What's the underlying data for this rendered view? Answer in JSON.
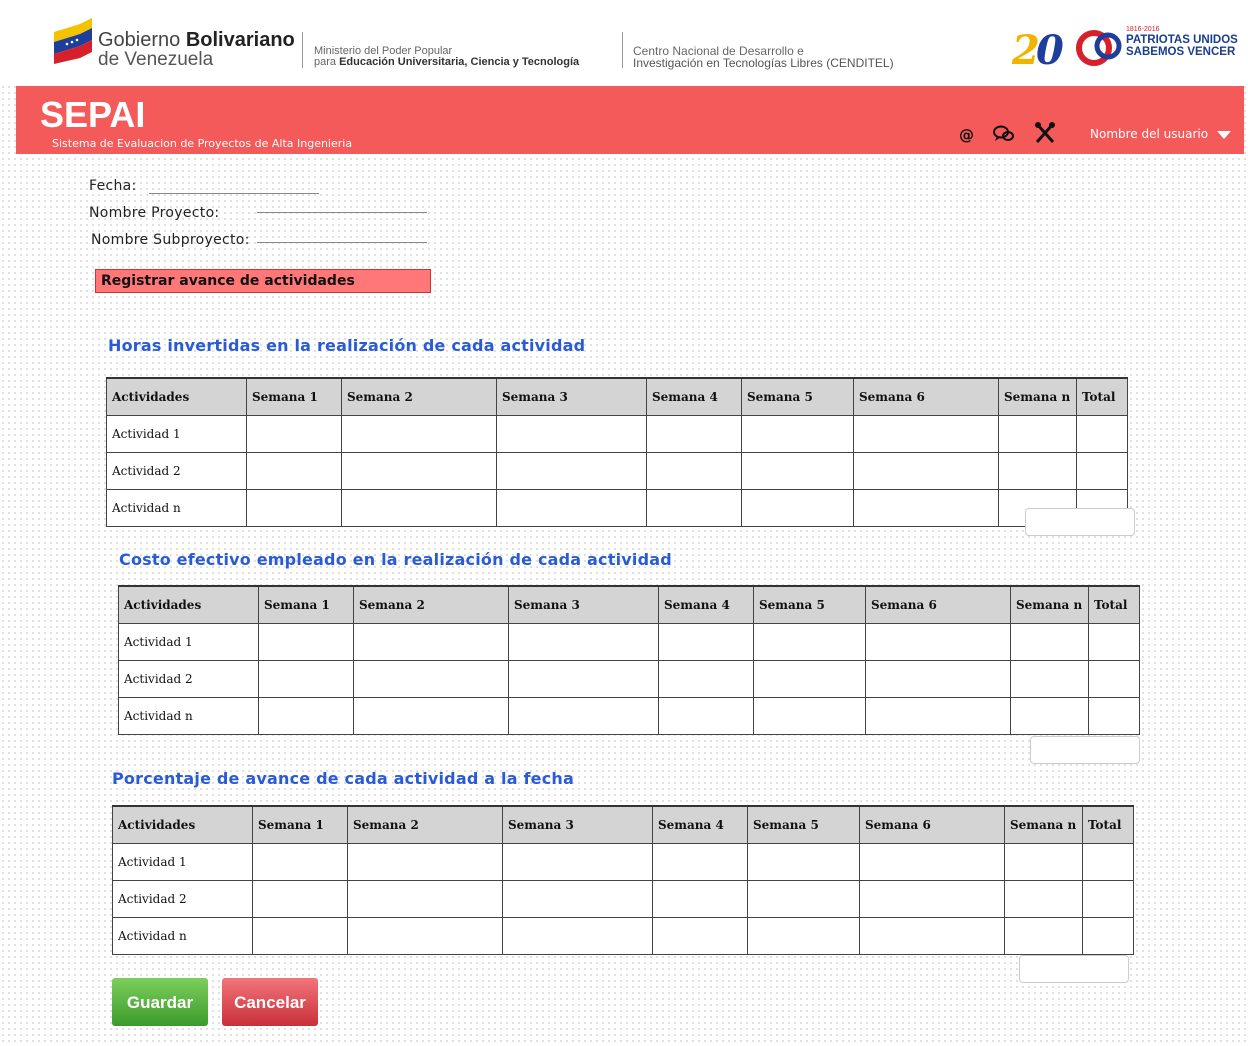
{
  "header": {
    "gov_line1_prefix": "Gobierno",
    "gov_line1_bold": "Bolivariano",
    "gov_line2": "de Venezuela",
    "ministry_line1": "Ministerio del Poder Popular",
    "ministry_line2_prefix": "para",
    "ministry_line2_bold": "Educación Universitaria, Ciencia y Tecnología",
    "center_line1": "Centro Nacional de Desarrollo e",
    "center_line2": "Investigación en Tecnologías Libres (CENDITEL)",
    "logo_years": "1816-2016",
    "logo_line1": "PATRIOTAS UNIDOS",
    "logo_line2": "SABEMOS VENCER"
  },
  "appbar": {
    "title": "SEPAI",
    "subtitle": "Sistema de Evaluacion de Proyectos de Alta Ingenieria",
    "icons": [
      "at-icon",
      "chat-icon",
      "tools-icon"
    ],
    "user_name": "Nombre del usuario",
    "color": "#f55a5a"
  },
  "form": {
    "fecha_label": "Fecha:",
    "proyecto_label": "Nombre Proyecto:",
    "subproyecto_label": "Nombre Subproyecto:",
    "section_button": "Registrar avance de actividades"
  },
  "columns": [
    "Actividades",
    "Semana 1",
    "Semana 2",
    "Semana 3",
    "Semana 4",
    "Semana 5",
    "Semana 6",
    "Semana n",
    "Total"
  ],
  "rows": [
    "Actividad 1",
    "Actividad 2",
    "Actividad n"
  ],
  "tables": [
    {
      "title": "Horas invertidas en la realización de cada actividad"
    },
    {
      "title": "Costo efectivo empleado en la realización de cada actividad"
    },
    {
      "title": "Porcentaje de avance de cada actividad a la fecha"
    }
  ],
  "buttons": {
    "save": "Guardar",
    "cancel": "Cancelar"
  },
  "colors": {
    "accent": "#2a5bd7",
    "save": "#4caf3a",
    "cancel": "#d9363e"
  }
}
